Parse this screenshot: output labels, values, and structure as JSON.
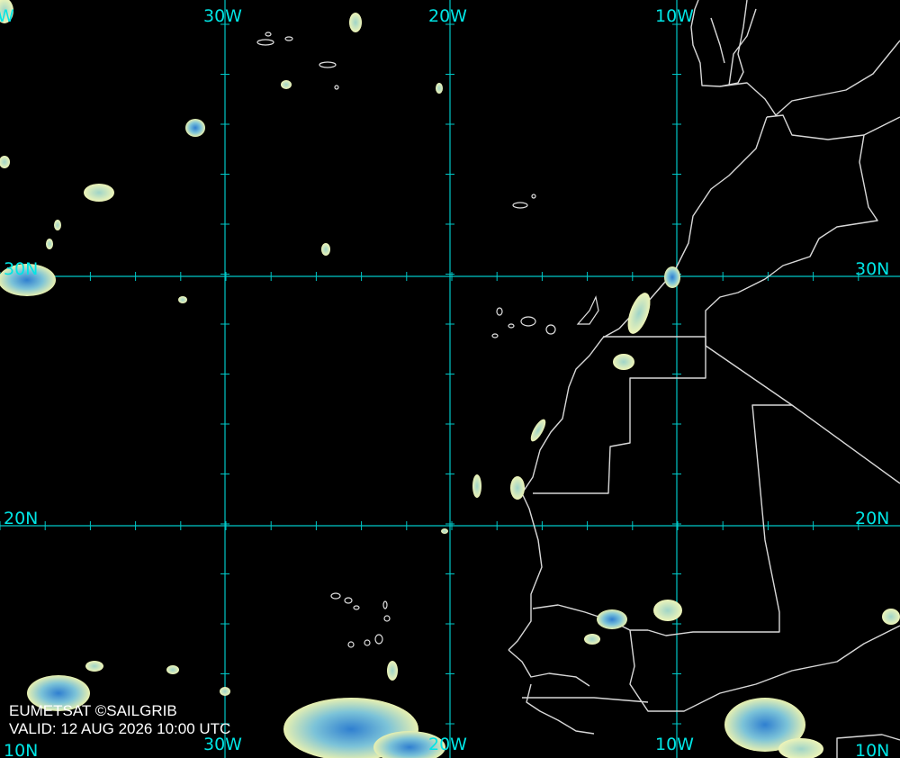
{
  "map": {
    "lon_labels": [
      "30W",
      "20W",
      "10W"
    ],
    "lat_labels": [
      "30N",
      "20N",
      "10N"
    ],
    "edge_labels": {
      "top_left_partial": "W",
      "left_partial_bottom": "10N"
    },
    "credit": "EUMETSAT ©SAILGRIB",
    "valid": "VALID:  12 AUG 2026 10:00 UTC",
    "colors": {
      "grid": "#00c8c8",
      "label": "#00e5e5",
      "coast": "#d8d8d8",
      "cloud_light": "#e8f0b0",
      "cloud_mid": "#9fd4c8",
      "cloud_deep": "#2f7fd0"
    }
  }
}
